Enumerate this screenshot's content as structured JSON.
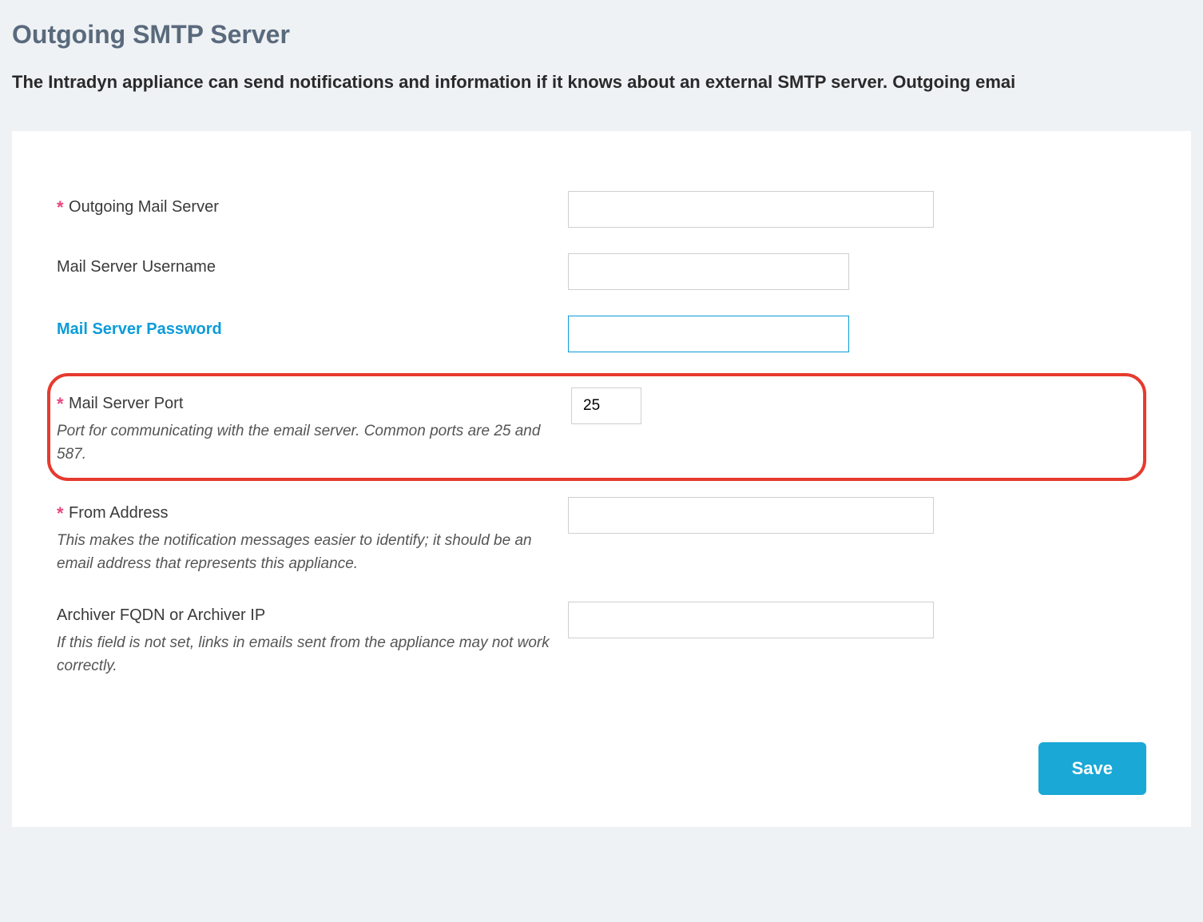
{
  "header": {
    "title": "Outgoing SMTP Server",
    "subtitle": "The Intradyn appliance can send notifications and information if it knows about an external SMTP server. Outgoing emai"
  },
  "form": {
    "required_mark": "*",
    "outgoing_mail_server": {
      "label": "Outgoing Mail Server",
      "value": "",
      "required": true
    },
    "mail_server_username": {
      "label": "Mail Server Username",
      "value": "",
      "required": false
    },
    "mail_server_password": {
      "label": "Mail Server Password",
      "value": "",
      "required": false
    },
    "mail_server_port": {
      "label": "Mail Server Port",
      "value": "25",
      "required": true,
      "hint": "Port for communicating with the email server. Common ports are 25 and 587."
    },
    "from_address": {
      "label": "From Address",
      "value": "",
      "required": true,
      "hint": "This makes the notification messages easier to identify; it should be an email address that represents this appliance."
    },
    "archiver_fqdn": {
      "label": "Archiver FQDN or Archiver IP",
      "value": "",
      "required": false,
      "hint": "If this field is not set, links in emails sent from the appliance may not work correctly."
    }
  },
  "actions": {
    "save_label": "Save"
  }
}
